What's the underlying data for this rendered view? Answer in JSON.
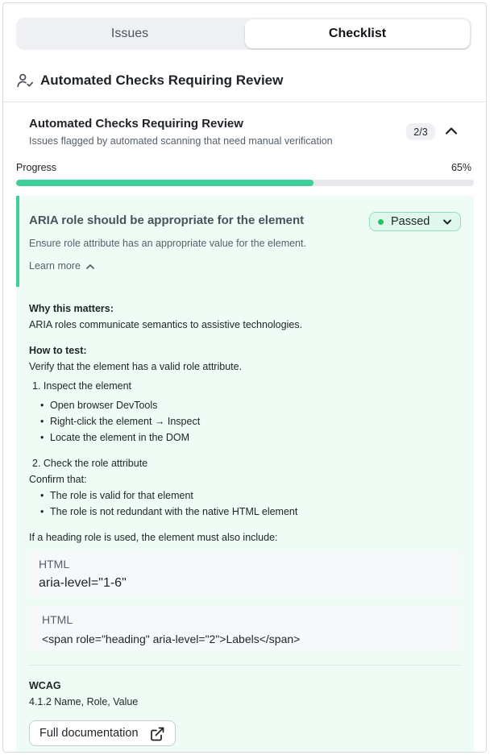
{
  "tabs": [
    {
      "label": "Issues",
      "active": false
    },
    {
      "label": "Checklist",
      "active": true
    }
  ],
  "section": {
    "title": "Automated Checks Requiring Review",
    "icon": "user-check-icon"
  },
  "group": {
    "title": "Automated Checks Requiring Review",
    "subtitle": "Issues flagged by automated scanning that need manual verification",
    "count": "2/3",
    "expanded": true
  },
  "progress": {
    "label": "Progress",
    "value_text": "65%",
    "value": 65
  },
  "check": {
    "title": "ARIA role should be appropriate for the element",
    "description": "Ensure role attribute has an appropriate value for the element.",
    "learn_more": "Learn more",
    "status": "Passed",
    "why_heading": "Why this matters:",
    "why_text": "ARIA roles communicate semantics to assistive technologies.",
    "how_heading": "How to test:",
    "how_text": "Verify that the element has a valid role attribute.",
    "step1_title": "1. Inspect the element",
    "step1_items": [
      "Open browser DevTools",
      "Right-click the element → Inspect",
      "Locate the element in the DOM"
    ],
    "step2_title": "2. Check the role attribute",
    "step2_intro": "Confirm that:",
    "step2_items": [
      "The role is valid for that element",
      "The role is not redundant with the native HTML element"
    ],
    "heading_note": "If a heading role is used, the element must also include:",
    "code_blocks": [
      {
        "lang": "HTML",
        "code": "aria-level=\"1-6\""
      },
      {
        "lang": "HTML",
        "code": "<span role=\"heading\" aria-level=\"2\">Labels</span>"
      }
    ],
    "wcag_heading": "WCAG",
    "wcag_text": "4.1.2 Name, Role, Value",
    "doc_button": "Full documentation"
  },
  "colors": {
    "accent": "#3ecf9a",
    "passed": "#22c55e",
    "card_bg": "#eefcf5"
  }
}
